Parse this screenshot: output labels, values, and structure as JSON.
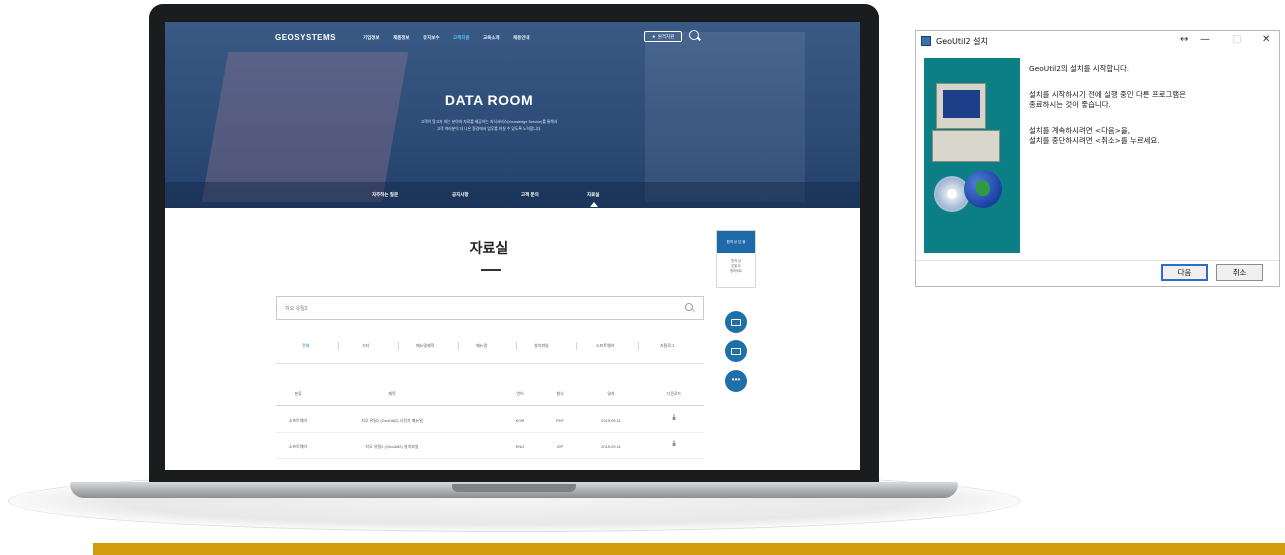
{
  "website": {
    "logo": "GEOSYSTEMS",
    "menu": [
      "기업정보",
      "제품정보",
      "유지보수",
      "고객지원",
      "교육소개",
      "채용안내"
    ],
    "menu_active_index": 3,
    "remote_button": "원격지원",
    "hero_title": "DATA ROOM",
    "hero_desc_line1": "고객이 알고자 하는 분야의 자료를 제공하는 지식서비스(Knowledge Service)를 통해서",
    "hero_desc_line2": "고객 여러분이 더 나은 환경에서 업무를 하실 수 있도록 노력합니다.",
    "subnav": [
      "자주하는 질문",
      "공지사항",
      "고객 문의",
      "자료실"
    ],
    "subnav_active_index": 3,
    "page_title": "자료실",
    "search_placeholder": "지오 유틸2",
    "categories": [
      "전체",
      "기타",
      "매뉴얼제작",
      "매뉴얼",
      "설치파일",
      "소프트웨어",
      "카탈로그"
    ],
    "category_active_index": 0,
    "table_headers": [
      "분류",
      "제목",
      "언어",
      "형식",
      "일자",
      "다운로드"
    ],
    "rows": [
      {
        "cat": "소프트웨어",
        "title": "지오 유틸2 (GeoUtil2) 사전가 매뉴얼",
        "lang": "KOR",
        "fmt": "PDF",
        "date": "2019.09.11"
      },
      {
        "cat": "소프트웨어",
        "title": "지오 유틸2 (GeoUtil2) 설치파일",
        "lang": "ENG",
        "fmt": "ZIP",
        "date": "2019.09.11"
      }
    ],
    "quick_title": "원격 상 담 중",
    "quick_body": [
      "원격 상",
      "담을 요",
      "청하세요"
    ]
  },
  "dialog": {
    "title": "GeoUtil2 설치",
    "titlebar_controls": [
      "↔",
      "—",
      "□",
      "✕"
    ],
    "line1": "GeoUtil2의 설치를 시작합니다.",
    "line2a": "설치를 시작하시기 전에 실행 중인 다른 프로그램은",
    "line2b": "종료하시는 것이 좋습니다.",
    "line3a": "설치를 계속하시려면 <다음>을,",
    "line3b": "설치를 중단하시려면 <취소>를 누르세요.",
    "btn_next": "다음",
    "btn_cancel": "취소"
  },
  "colors": {
    "accent_gold": "#d09c0d",
    "hero_blue": "#2c4b76",
    "dialog_art_teal": "#0b7f84"
  }
}
